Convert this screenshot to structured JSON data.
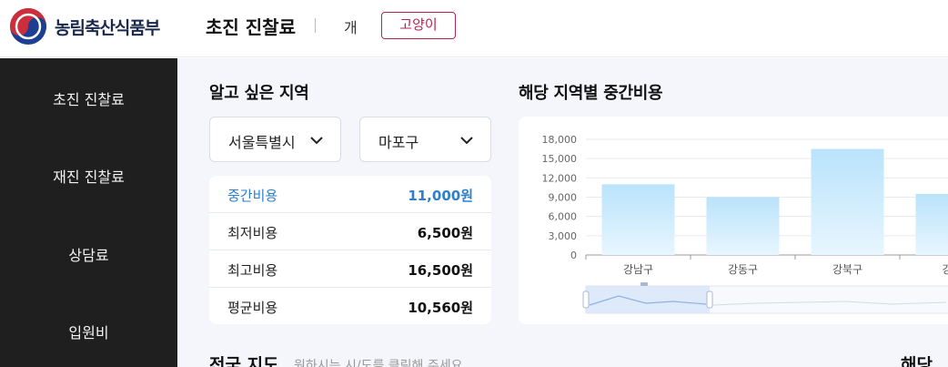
{
  "header": {
    "brand": "농림축산식품부",
    "page_title": "초진 진찰료",
    "pet_tabs": [
      {
        "label": "개",
        "active": false
      },
      {
        "label": "고양이",
        "active": true
      }
    ],
    "accent_color": "#b6264f"
  },
  "sidebar": {
    "items": [
      {
        "label": "초진 진찰료"
      },
      {
        "label": "재진 진찰료"
      },
      {
        "label": "상담료"
      },
      {
        "label": "입원비"
      }
    ]
  },
  "region": {
    "title": "알고 싶은 지역",
    "city_select": "서울특별시",
    "district_select": "마포구"
  },
  "costs": {
    "rows": [
      {
        "label": "중간비용",
        "value": "11,000원",
        "highlight": true
      },
      {
        "label": "최저비용",
        "value": "6,500원"
      },
      {
        "label": "최고비용",
        "value": "16,500원"
      },
      {
        "label": "평균비용",
        "value": "10,560원"
      }
    ],
    "highlight_color": "#2f7fcc"
  },
  "chart_section": {
    "title": "해당 지역별 중간비용"
  },
  "chart_data": {
    "type": "bar",
    "categories": [
      "강남구",
      "강동구",
      "강북구",
      "강서구"
    ],
    "visible_category_labels": [
      "강남구",
      "강동구",
      "강북구",
      "강서"
    ],
    "values": [
      11000,
      9000,
      16500,
      9500
    ],
    "ylim": [
      0,
      18000
    ],
    "yticks": [
      "0",
      "3,000",
      "6,000",
      "9,000",
      "12,000",
      "15,000",
      "18,000"
    ],
    "ytick_values": [
      0,
      3000,
      6000,
      9000,
      12000,
      15000,
      18000
    ],
    "bar_color": "#bfe6fb",
    "grid": true
  },
  "map_section": {
    "title": "전국 지도",
    "subtitle": "원하시는 시/도를 클릭해 주세요",
    "right_title": "해당"
  }
}
